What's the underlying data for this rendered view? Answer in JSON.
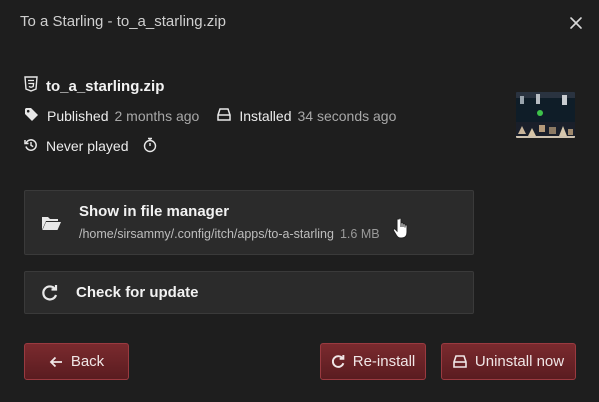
{
  "dialog": {
    "title": "To a Starling - to_a_starling.zip"
  },
  "file": {
    "name": "to_a_starling.zip",
    "icon": "html5-icon"
  },
  "meta": {
    "published_label": "Published",
    "published_value": "2 months ago",
    "installed_label": "Installed",
    "installed_value": "34 seconds ago",
    "played_label": "Never played"
  },
  "actions": {
    "file_manager_title": "Show in file manager",
    "file_manager_path": "/home/sirsammy/.config/itch/apps/to-a-starling",
    "file_manager_size": "1.6 MB",
    "check_update_label": "Check for update"
  },
  "footer": {
    "back_label": "Back",
    "reinstall_label": "Re-install",
    "uninstall_label": "Uninstall now"
  },
  "colors": {
    "accent": "#7a2a2e",
    "background": "#1e1e1e"
  }
}
